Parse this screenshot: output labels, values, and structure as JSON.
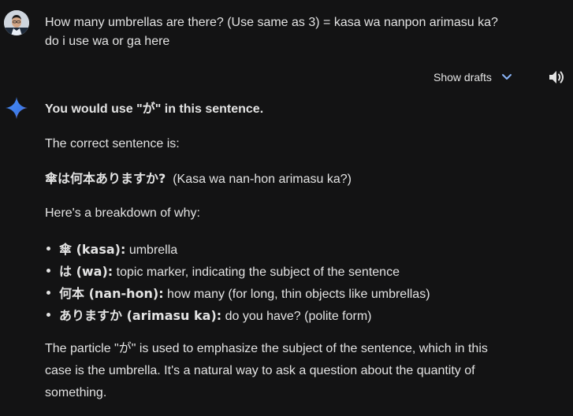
{
  "user_message": {
    "line1": "How many umbrellas are there? (Use same as 3) = kasa wa nanpon arimasu ka?",
    "line2": "do i use wa or ga here"
  },
  "toolbar": {
    "show_drafts_label": "Show drafts",
    "chevron_icon": "chevron-down-icon",
    "speaker_icon": "volume-icon"
  },
  "response": {
    "heading": "You would use \"が\" in this sentence.",
    "correct_intro": "The correct sentence is:",
    "sentence_jp": "傘は何本ありますか?",
    "sentence_romaji": "(Kasa wa nan-hon arimasu ka?)",
    "breakdown_intro": "Here's a breakdown of why:",
    "bullets": [
      {
        "term": "傘 (kasa):",
        "desc": "umbrella"
      },
      {
        "term": "は (wa):",
        "desc": "topic marker, indicating the subject of the sentence"
      },
      {
        "term": "何本 (nan-hon):",
        "desc": "how many (for long, thin objects like umbrellas)"
      },
      {
        "term": "ありますか (arimasu ka):",
        "desc": "do you have? (polite form)"
      }
    ],
    "para_line1": "The particle \"が\" is used to emphasize the subject of the sentence, which in this",
    "para_line2": "case is the umbrella. It's a natural way to ask a question about the quantity of",
    "para_line3": "something."
  },
  "colors": {
    "background": "#131314",
    "text": "#e3e3e3",
    "accent_blue": "#8ab4f8"
  }
}
